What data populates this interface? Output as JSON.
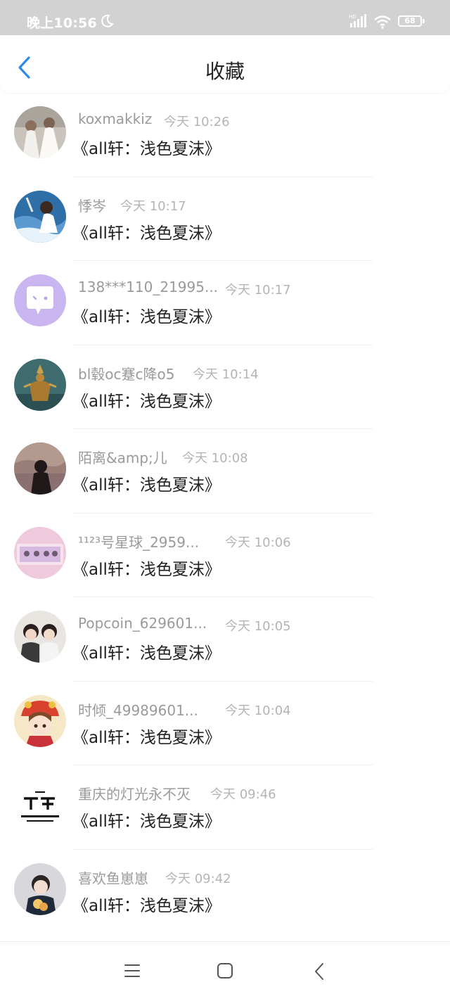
{
  "status_bar": {
    "time": "晚上10:56",
    "signal_badge": "HD",
    "battery": "68"
  },
  "header": {
    "title": "收藏",
    "back_icon": "chevron-left-icon",
    "accent_color": "#2a8ce8"
  },
  "items": [
    {
      "name": "koxmakkiz",
      "time": "今天 10:26",
      "message": "《all轩：浅色夏沫》"
    },
    {
      "name": "悸岑",
      "time": "今天 10:17",
      "message": "《all轩：浅色夏沫》"
    },
    {
      "name": "138***110_21995...",
      "time": "今天 10:17",
      "message": "《all轩：浅色夏沫》"
    },
    {
      "name": "bl毂oc蹇c降o5",
      "time": "今天 10:14",
      "message": "《all轩：浅色夏沫》"
    },
    {
      "name": "陌离&amp;儿",
      "time": "今天 10:08",
      "message": "《all轩：浅色夏沫》"
    },
    {
      "name": "¹¹²³号星球_2959...",
      "time": "今天 10:06",
      "message": "《all轩：浅色夏沫》"
    },
    {
      "name": "Popcoin_629601...",
      "time": "今天 10:05",
      "message": "《all轩：浅色夏沫》"
    },
    {
      "name": "时倾_49989601...",
      "time": "今天 10:04",
      "message": "《all轩：浅色夏沫》"
    },
    {
      "name": "重庆的灯光永不灭",
      "time": "今天 09:46",
      "message": "《all轩：浅色夏沫》"
    },
    {
      "name": "喜欢鱼崽崽",
      "time": "今天 09:42",
      "message": "《all轩：浅色夏沫》"
    }
  ],
  "nav_bar": {
    "menu_icon": "menu-icon",
    "home_icon": "home-square-icon",
    "back_icon": "back-triangle-icon"
  }
}
